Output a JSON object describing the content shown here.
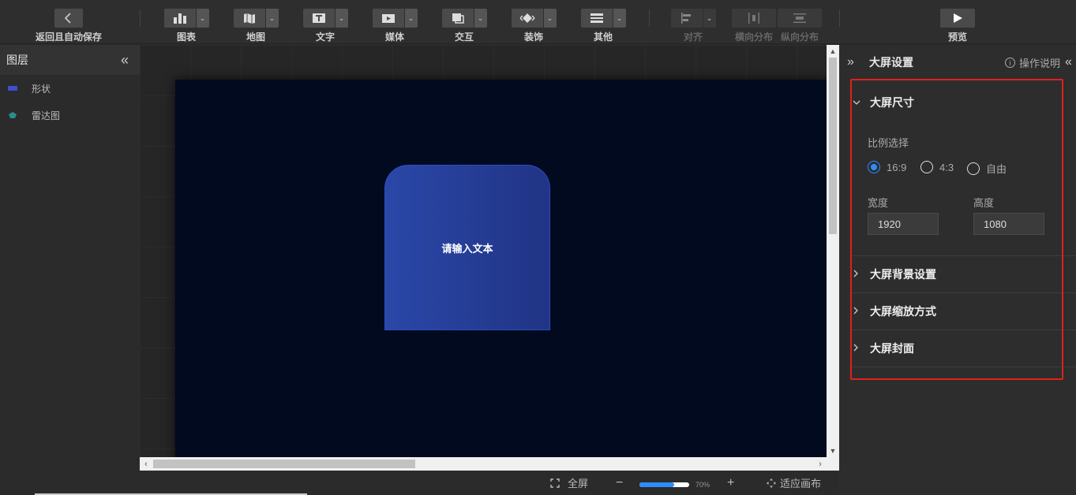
{
  "toolbar": {
    "back": {
      "label": "返回且自动保存",
      "icon": "chevron-left-icon"
    },
    "items": [
      {
        "label": "图表",
        "icon": "chart-icon"
      },
      {
        "label": "地图",
        "icon": "map-icon"
      },
      {
        "label": "文字",
        "icon": "text-icon"
      },
      {
        "label": "媒体",
        "icon": "media-icon"
      },
      {
        "label": "交互",
        "icon": "interaction-icon"
      },
      {
        "label": "装饰",
        "icon": "decoration-icon"
      },
      {
        "label": "其他",
        "icon": "more-icon"
      }
    ],
    "align": [
      {
        "label": "对齐",
        "icon": "align-left-icon",
        "disabled": true
      },
      {
        "label": "横向分布",
        "icon": "distribute-horizontal-icon",
        "disabled": true
      },
      {
        "label": "纵向分布",
        "icon": "distribute-vertical-icon",
        "disabled": true
      }
    ],
    "preview": {
      "label": "预览",
      "icon": "play-icon"
    }
  },
  "layers": {
    "title": "图层",
    "collapse_icon": "«",
    "items": [
      {
        "label": "形状",
        "icon": "shape-icon",
        "color": "#3b4fd0"
      },
      {
        "label": "雷达图",
        "icon": "radar-icon",
        "color": "#2a8c8c"
      }
    ]
  },
  "canvas": {
    "background": "#010a1f",
    "shape_text": "请输入文本",
    "shape_colors": [
      "#2a47a8",
      "#213485"
    ]
  },
  "bottom_bar": {
    "fullscreen": "全屏",
    "zoom_out": "−",
    "zoom_in": "+",
    "zoom_value": "70%",
    "zoom_fraction": 0.7,
    "fit_canvas": "适应画布"
  },
  "right_panel": {
    "title": "大屏设置",
    "expand_icon": "»",
    "collapse_icon": "«",
    "help": "操作说明",
    "sections": {
      "size": {
        "title": "大屏尺寸",
        "expanded": true,
        "ratio_label": "比例选择",
        "ratios": [
          {
            "label": "16:9",
            "selected": true
          },
          {
            "label": "4:3",
            "selected": false
          },
          {
            "label": "自由",
            "selected": false
          }
        ],
        "width_label": "宽度",
        "width_value": "1920",
        "height_label": "高度",
        "height_value": "1080"
      },
      "background": {
        "title": "大屏背景设置",
        "expanded": false
      },
      "scaling": {
        "title": "大屏缩放方式",
        "expanded": false
      },
      "cover": {
        "title": "大屏封面",
        "expanded": false
      }
    }
  },
  "colors": {
    "accent": "#2f8cff",
    "highlight_box": "#e0201b"
  }
}
